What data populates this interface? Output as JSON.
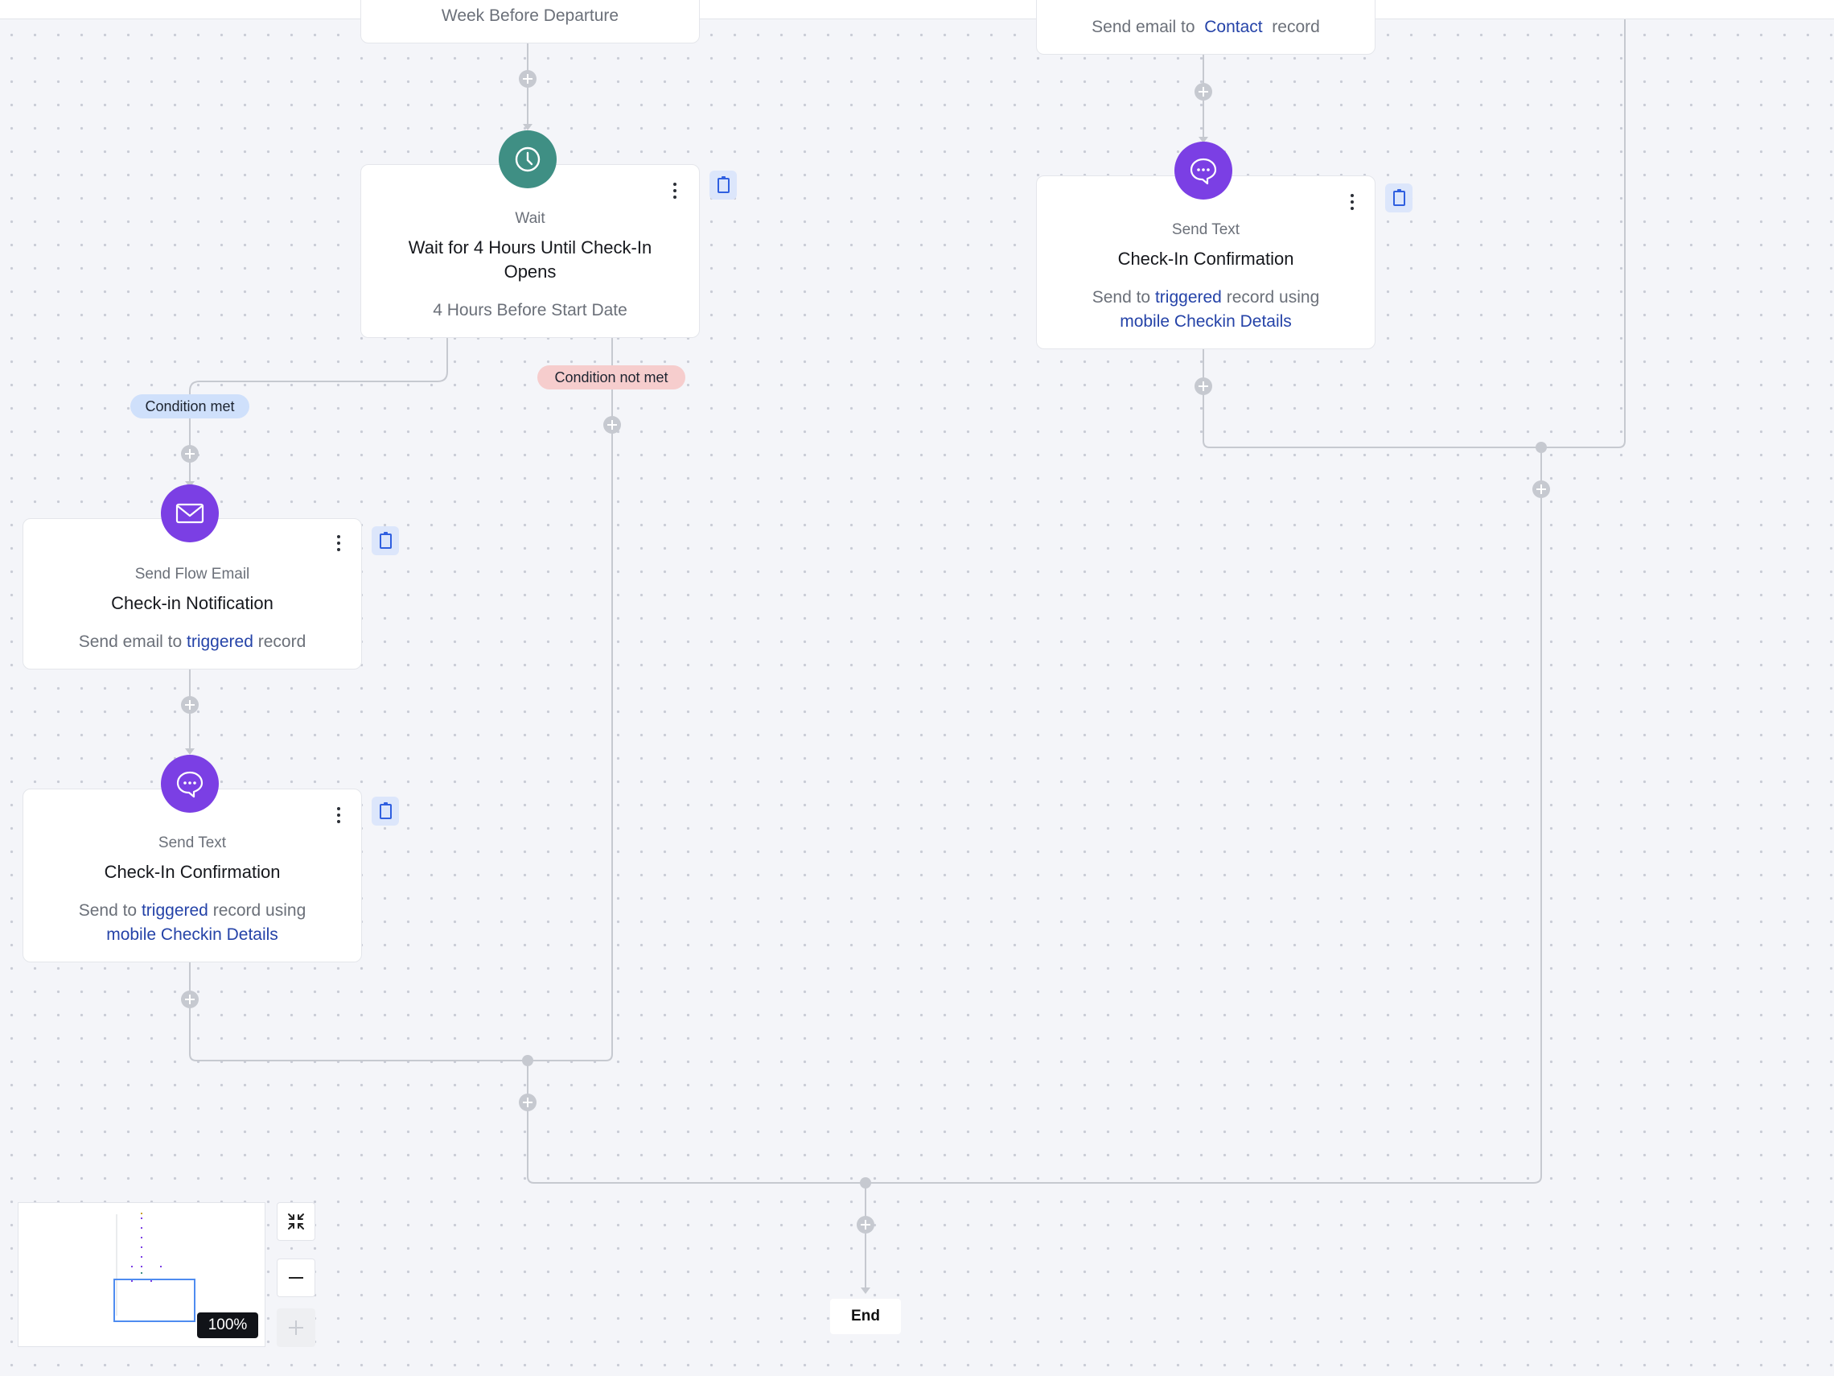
{
  "canvas": {
    "top_card": {
      "desc_partial": "Week Before Departure"
    },
    "wait_card": {
      "kind": "Wait",
      "title": "Wait for 4 Hours Until Check-In Opens",
      "desc": "4 Hours Before Start Date"
    },
    "right_email_card": {
      "desc_prefix": "Send email to",
      "desc_link": "Contact",
      "desc_suffix": "record"
    },
    "right_text_card": {
      "kind": "Send Text",
      "title": "Check-In Confirmation",
      "desc_prefix": "Send to",
      "desc_link": "triggered",
      "desc_middle": "record using",
      "desc_link2": "mobile Checkin Details"
    },
    "badges": {
      "condition_met": "Condition met",
      "condition_not_met": "Condition not met"
    },
    "email_card": {
      "kind": "Send Flow Email",
      "title": "Check-in Notification",
      "desc_prefix": "Send email to",
      "desc_link": "triggered",
      "desc_suffix": "record"
    },
    "left_text_card": {
      "kind": "Send Text",
      "title": "Check-In Confirmation",
      "desc_prefix": "Send to",
      "desc_link": "triggered",
      "desc_middle": "record using",
      "desc_link2": "mobile Checkin Details"
    },
    "end_label": "End"
  },
  "minimap": {
    "zoom_label": "100%"
  },
  "icons": {
    "wait": "clock-icon",
    "email": "envelope-icon",
    "text": "chat-bubble-icon",
    "menu": "kebab-menu-icon",
    "copy": "clipboard-icon",
    "add": "plus-circle-icon",
    "fit": "collapse-arrows-icon",
    "zoom_out": "minus-icon",
    "zoom_in": "plus-icon"
  },
  "colors": {
    "wait_node": "#3f8f84",
    "action_node": "#7b3fe4",
    "link": "#2543a8",
    "condition_met": "#cfe0fb",
    "condition_not_met": "#f6cdcd",
    "connector": "#c6c9d0"
  }
}
